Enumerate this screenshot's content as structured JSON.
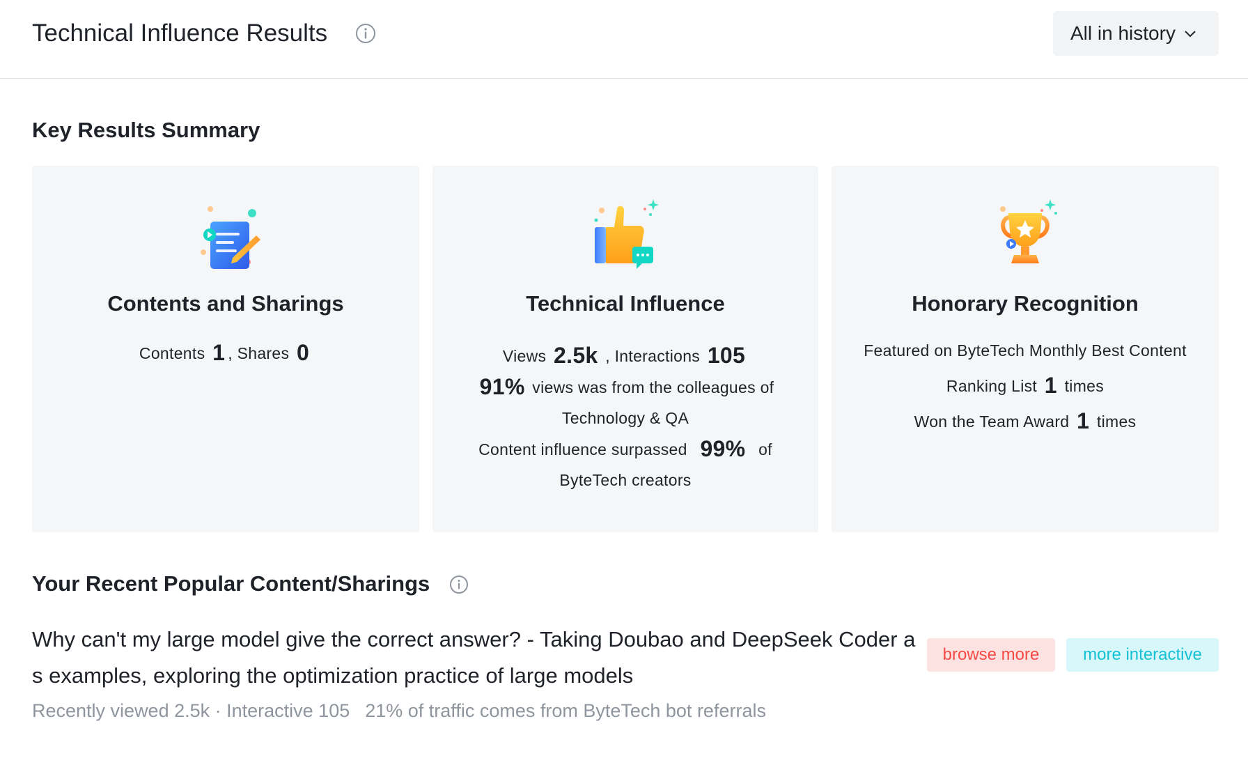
{
  "header": {
    "title": "Technical Influence Results",
    "range_select": "All in history"
  },
  "summary": {
    "title": "Key Results Summary",
    "cards": [
      {
        "icon": "document-edit-icon",
        "title": "Contents and Sharings",
        "contents_label": "Contents",
        "contents_value": "1",
        "shares_label": ", Shares",
        "shares_value": "0"
      },
      {
        "icon": "thumbs-up-icon",
        "title": "Technical Influence",
        "views_label": "Views",
        "views_value": "2.5k",
        "interactions_label": ", Interactions",
        "interactions_value": "105",
        "colleagues_pct": "91%",
        "colleagues_text_1": "views was from the colleagues of",
        "colleagues_text_2": "Technology & QA",
        "surpassed_label": "Content influence surpassed",
        "surpassed_pct": "99%",
        "surpassed_of": "of",
        "surpassed_text_2": "ByteTech creators"
      },
      {
        "icon": "trophy-icon",
        "title": "Honorary Recognition",
        "featured_text_1": "Featured on ByteTech Monthly Best Content",
        "featured_text_2": "Ranking List",
        "featured_value": "1",
        "featured_times": "times",
        "award_label": "Won the Team Award",
        "award_value": "1",
        "award_times": "times"
      }
    ]
  },
  "popular": {
    "title": "Your Recent Popular Content/Sharings",
    "article": {
      "title": "Why can't my large model give the correct answer? - Taking Doubao and DeepSeek Coder as examples, exploring the optimization practice of large models",
      "tags": [
        "browse more",
        "more interactive"
      ],
      "meta_stats": "Recently viewed 2.5k · Interactive 105",
      "meta_traffic": "21% of traffic comes from ByteTech bot referrals"
    }
  },
  "colors": {
    "text": "#1f2329",
    "muted": "#8f959e",
    "card_bg": "#f5f6f7",
    "tag_red": "#f54a45",
    "tag_cyan": "#14c0d4"
  }
}
